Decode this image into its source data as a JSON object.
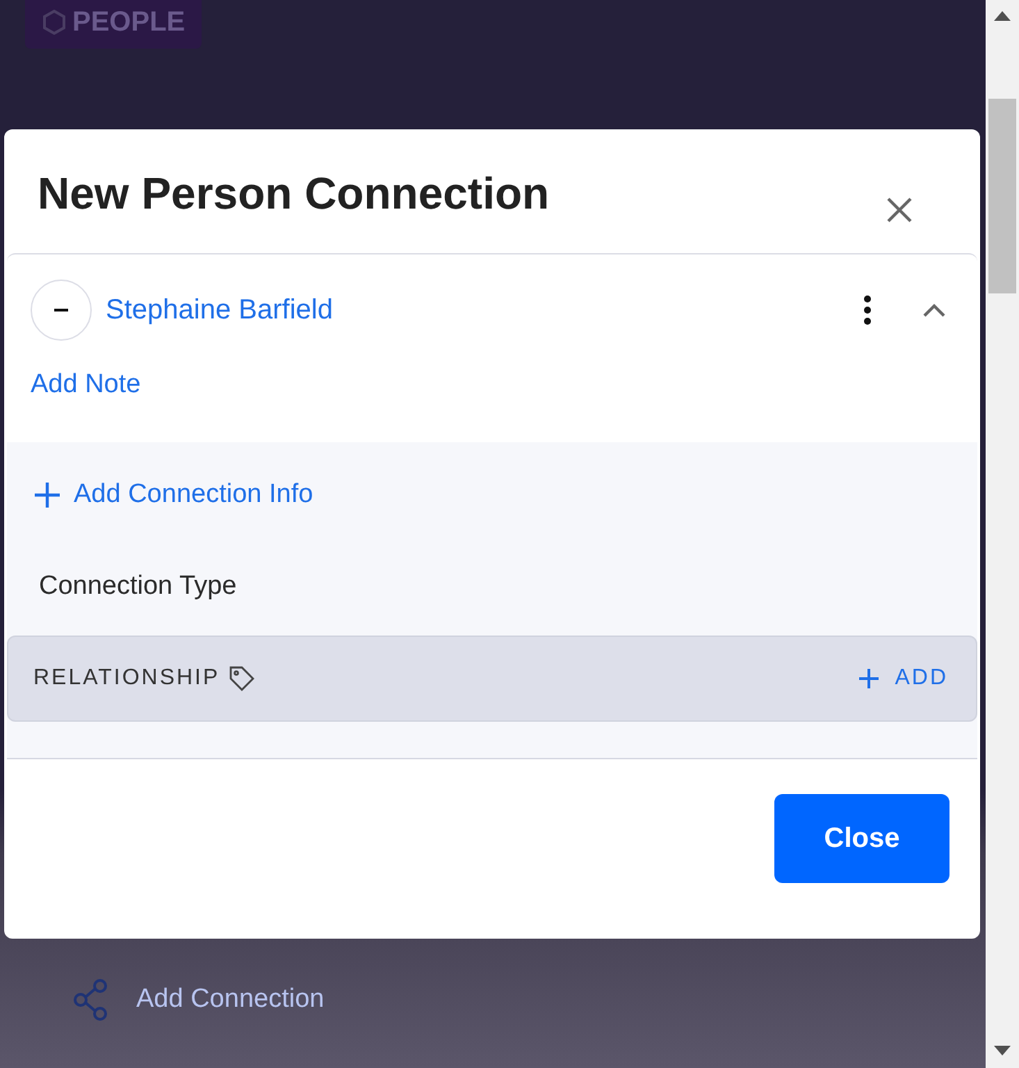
{
  "background": {
    "badge": "PEOPLE",
    "action": "Add Connection"
  },
  "dialog": {
    "title": "New Person Connection",
    "person": {
      "name": "Stephaine Barfield",
      "expanded": true,
      "note_link": "Add Note"
    },
    "add_info": "Add Connection Info",
    "section_label": "Connection Type",
    "tag_row": {
      "label": "RELATIONSHIP",
      "action": "ADD"
    },
    "buttons": [
      "Close"
    ]
  }
}
